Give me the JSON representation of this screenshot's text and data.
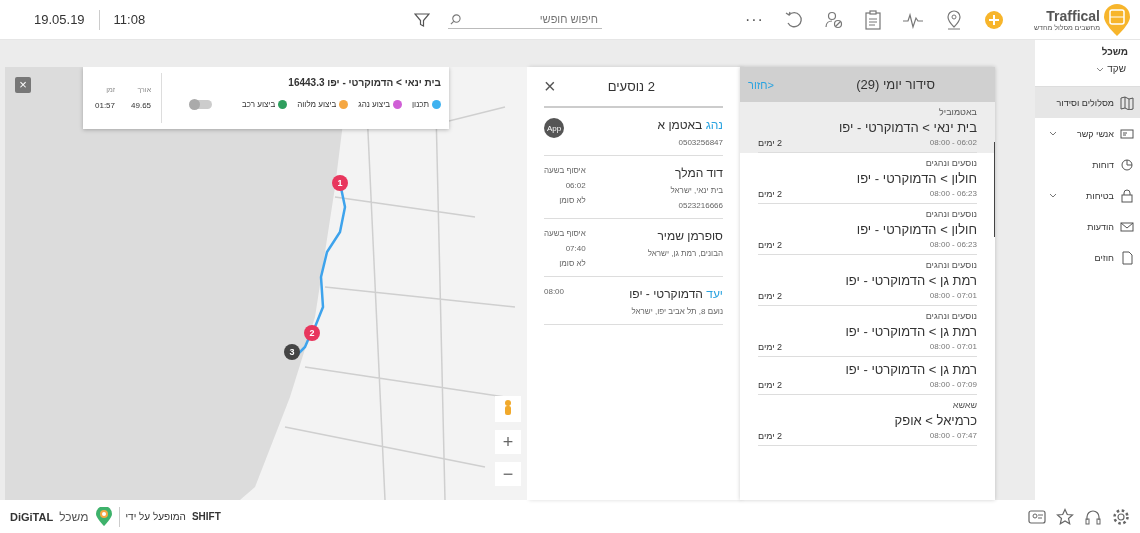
{
  "topbar": {
    "date": "19.05.19",
    "time": "11:08",
    "search": {
      "placeholder": "חיפוש חופשי"
    },
    "more": "···",
    "logo": {
      "name": "Traffical",
      "tagline": "מחשבים מסלול מחדש"
    }
  },
  "sidebar": {
    "org": "משכל",
    "user": "שקד",
    "items": [
      {
        "label": "מסלולים וסידור",
        "selected": true,
        "expandable": false
      },
      {
        "label": "אנשי קשר",
        "selected": false,
        "expandable": true
      },
      {
        "label": "דוחות",
        "selected": false,
        "expandable": false
      },
      {
        "label": "בטיחות",
        "selected": false,
        "expandable": true
      },
      {
        "label": "הודעות",
        "selected": false,
        "expandable": false
      },
      {
        "label": "חוזים",
        "selected": false,
        "expandable": false
      }
    ]
  },
  "schedule": {
    "back": "<חזור",
    "title": "סידור יומי (29)",
    "items": [
      {
        "category": "באטמוביל",
        "route": "בית ינאי > הדמוקרטי - יפו",
        "time": "06:02 - 08:00",
        "days": "2 ימים",
        "selected": true
      },
      {
        "category": "נוסעים ונהגים",
        "route": "חולון > הדמוקרטי - יפו",
        "time": "06:23 - 08:00",
        "days": "2 ימים",
        "selected": false
      },
      {
        "category": "נוסעים ונהגים",
        "route": "חולון > הדמוקרטי - יפו",
        "time": "06:23 - 08:00",
        "days": "2 ימים",
        "selected": false
      },
      {
        "category": "נוסעים ונהגים",
        "route": "רמת גן > הדמוקרטי - יפו",
        "time": "07:01 - 08:00",
        "days": "2 ימים",
        "selected": false
      },
      {
        "category": "נוסעים ונהגים",
        "route": "רמת גן > הדמוקרטי - יפו",
        "time": "07:01 - 08:00",
        "days": "2 ימים",
        "selected": false
      },
      {
        "route": "רמת גן > הדמוקרטי - יפו",
        "time": "07:09 - 08:00",
        "days": "2 ימים",
        "selected": false
      },
      {
        "category": "שאשא",
        "route": "כרמיאל > אופק",
        "time": "07:47 - 08:00",
        "days": "2 ימים",
        "selected": false
      }
    ]
  },
  "passengers": {
    "title": "2 נוסעים",
    "close": "×",
    "driver": {
      "role": "נהג",
      "name": "באטמן א",
      "phone": "0503256847",
      "badge": "App"
    },
    "stops": [
      {
        "kind": "passenger",
        "name": "דוד המלך",
        "address": "בית ינאי, ישראל",
        "phone": "0523216666",
        "pickup_label": "איסוף בשעה",
        "pickup_time": "06:02",
        "status": "לא סומן"
      },
      {
        "kind": "passenger",
        "name": "סופרמן שמיר",
        "address": "הבונים, רמת גן, ישראל",
        "pickup_label": "איסוף בשעה",
        "pickup_time": "07:40",
        "status": "לא סומן"
      },
      {
        "kind": "destination",
        "role": "יעד",
        "name": "הדמוקרטי - יפו",
        "address": "נועם 8, תל אביב יפו, ישראל",
        "pickup_time": "08:00"
      }
    ]
  },
  "route_card": {
    "title": "בית ינאי > הדמוקרטי - יפו 16443.3",
    "legend": [
      {
        "label": "תכנון",
        "color": "#3eb2f0"
      },
      {
        "label": "ביצוע נהג",
        "color": "#d05fd6"
      },
      {
        "label": "ביצוע מלווה",
        "color": "#f5a742"
      },
      {
        "label": "ביצוע רכב",
        "color": "#2e9e5e"
      }
    ],
    "toggle": {
      "on": false
    },
    "length_label": "אורך",
    "length": "49.65",
    "time_label": "זמן",
    "time": "01:57"
  },
  "map": {
    "close": "×",
    "zoom_in": "+",
    "zoom_out": "−",
    "markers": [
      {
        "label": "1",
        "color": "#e8365d"
      },
      {
        "label": "2",
        "color": "#e8365d"
      },
      {
        "label": "3",
        "color": "#444444"
      }
    ]
  },
  "footer": {
    "logo": "משכל",
    "logo_sub": "DiGiTAL",
    "powered_by": "המופעל על ידי",
    "brand": "SHIFT"
  }
}
